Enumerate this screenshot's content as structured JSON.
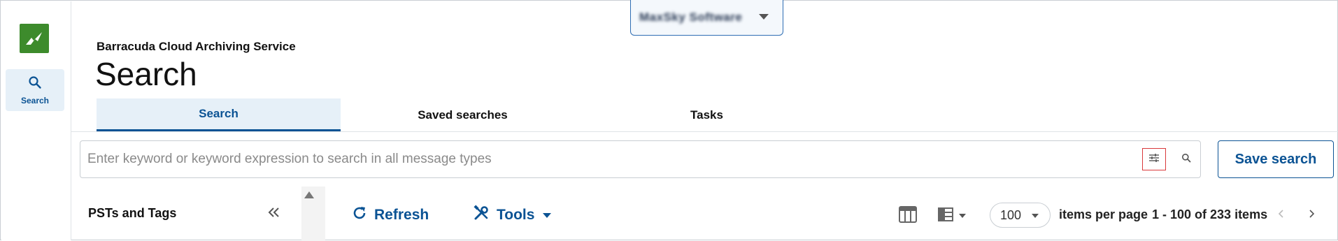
{
  "account": {
    "name": "MaxSky Software"
  },
  "nav": {
    "search_label": "Search"
  },
  "header": {
    "product": "Barracuda Cloud Archiving Service",
    "title": "Search"
  },
  "tabs": [
    {
      "label": "Search",
      "active": true
    },
    {
      "label": "Saved searches",
      "active": false
    },
    {
      "label": "Tasks",
      "active": false
    }
  ],
  "search": {
    "placeholder": "Enter keyword or keyword expression to search in all message types",
    "value": "",
    "save_label": "Save search"
  },
  "panel": {
    "title": "PSTs and Tags"
  },
  "toolbar": {
    "refresh_label": "Refresh",
    "tools_label": "Tools",
    "per_page_value": "100",
    "per_page_label": "items per page",
    "range_label": "1 - 100 of 233 items"
  },
  "icons": {
    "logo": "barracuda-logo-icon",
    "nav_search": "search-icon",
    "filter": "sliders-icon",
    "search": "search-icon",
    "collapse": "double-chevron-left-icon",
    "refresh": "refresh-icon",
    "tools": "tools-icon",
    "grid_view": "table-icon",
    "layout": "reading-pane-icon",
    "prev": "chevron-left-icon",
    "next": "chevron-right-icon"
  },
  "colors": {
    "brand_green": "#3d8b2c",
    "accent_blue": "#0b5394",
    "active_tab_bg": "#e6f0f8",
    "filter_highlight": "#d9393b"
  }
}
